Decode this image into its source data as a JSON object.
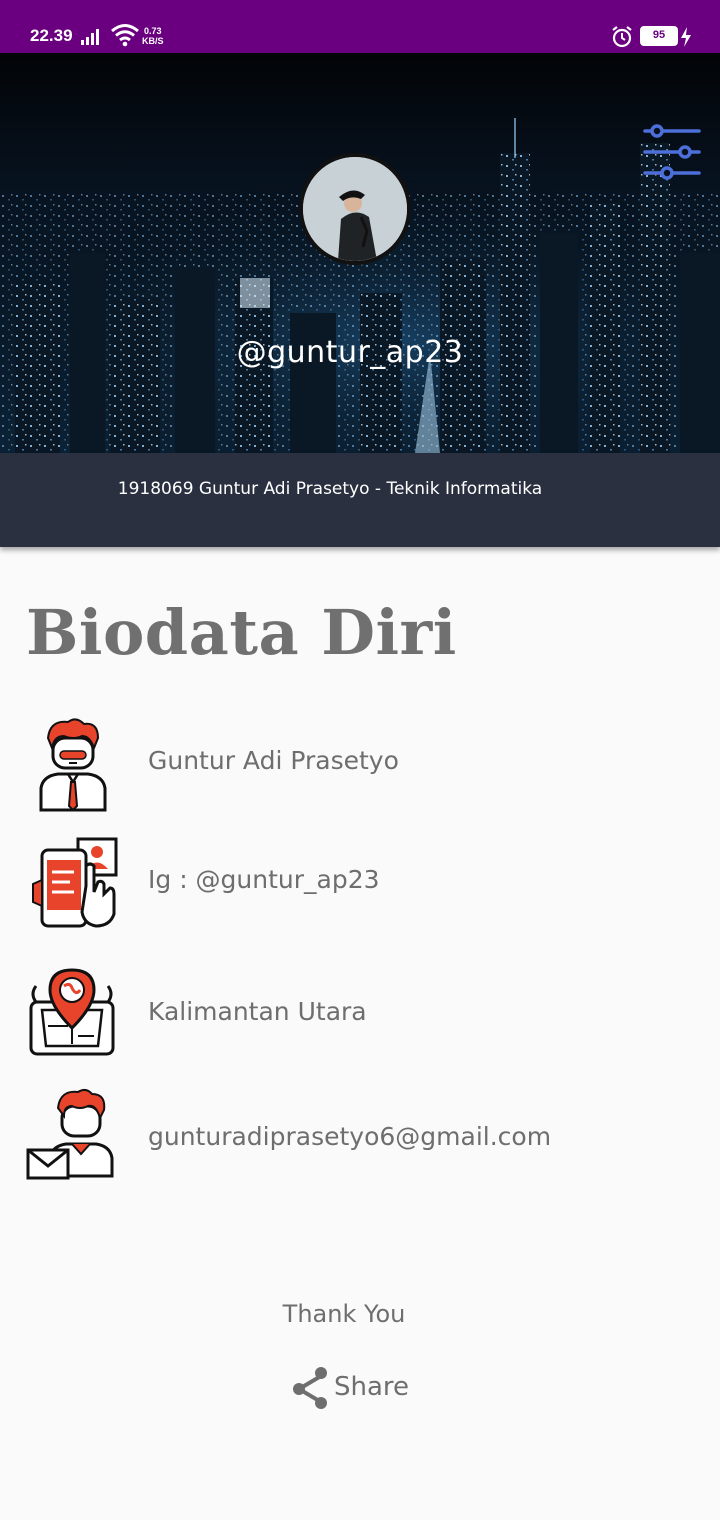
{
  "status_bar": {
    "time": "22.39",
    "net_speed_value": "0.73",
    "net_speed_unit": "KB/S",
    "battery": "95"
  },
  "profile": {
    "username": "@guntur_ap23",
    "info_line": "1918069 Guntur Adi Prasetyo - Teknik Informatika"
  },
  "page": {
    "title": "Biodata Diri"
  },
  "biodata": [
    {
      "icon": "person-icon",
      "text": "Guntur Adi Prasetyo"
    },
    {
      "icon": "social-media-icon",
      "text": "Ig : @guntur_ap23"
    },
    {
      "icon": "location-icon",
      "text": "Kalimantan Utara"
    },
    {
      "icon": "email-icon",
      "text": "gunturadiprasetyo6@gmail.com"
    }
  ],
  "footer": {
    "thanks": "Thank You",
    "share_label": "Share"
  },
  "colors": {
    "status_bar": "#6a0080",
    "strip": "#2b3040",
    "accent_icon": "#4d6fd9",
    "text_gray": "#6e6e6e",
    "icon_red": "#e8442c"
  }
}
